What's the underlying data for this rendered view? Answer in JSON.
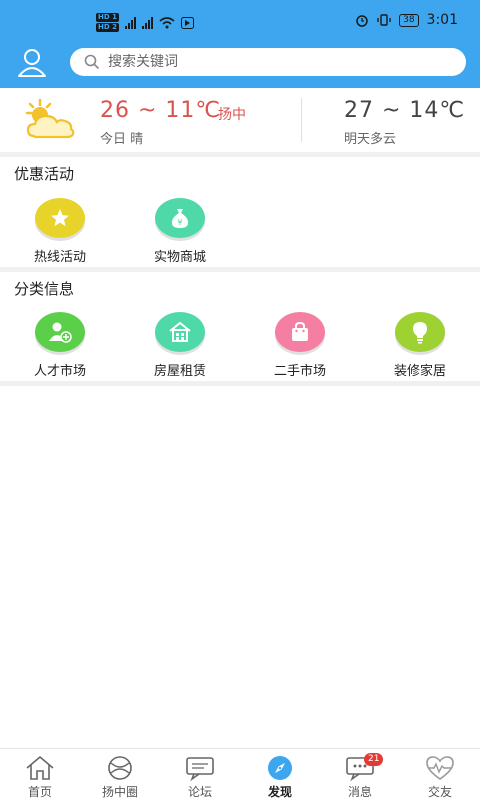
{
  "status_bar": {
    "time": "3:01",
    "battery": "38"
  },
  "search": {
    "placeholder": "搜索关键词"
  },
  "weather": {
    "today_temp": "26 ~ 11℃",
    "city": "扬中",
    "today_desc": "今日 晴",
    "tomorrow_temp": "27 ~ 14℃",
    "tomorrow_desc": "明天多云"
  },
  "promotions": {
    "title": "优惠活动",
    "items": [
      {
        "label": "热线活动",
        "icon": "star-icon",
        "color": "#e8d32b"
      },
      {
        "label": "实物商城",
        "icon": "money-bag-icon",
        "color": "#4fd8a8"
      }
    ]
  },
  "categories": {
    "title": "分类信息",
    "items": [
      {
        "label": "人才市场",
        "icon": "user-add-icon",
        "color": "#5ccf4a"
      },
      {
        "label": "房屋租赁",
        "icon": "house-icon",
        "color": "#4fd8a8"
      },
      {
        "label": "二手市场",
        "icon": "bag-icon",
        "color": "#f57fa3"
      },
      {
        "label": "装修家居",
        "icon": "lightbulb-icon",
        "color": "#9ed132"
      }
    ]
  },
  "tabs": [
    {
      "label": "首页",
      "icon": "home-icon"
    },
    {
      "label": "扬中圈",
      "icon": "circle-icon"
    },
    {
      "label": "论坛",
      "icon": "chat-icon"
    },
    {
      "label": "发现",
      "icon": "compass-icon",
      "active": true
    },
    {
      "label": "消息",
      "icon": "message-icon",
      "badge": "21"
    },
    {
      "label": "交友",
      "icon": "heart-icon"
    }
  ]
}
